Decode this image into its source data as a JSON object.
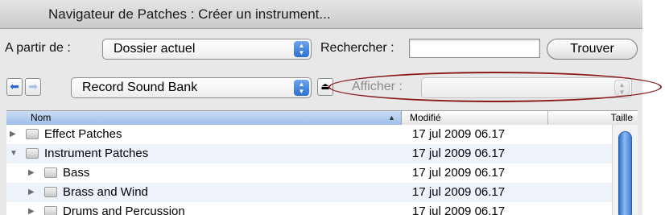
{
  "window": {
    "title": "Navigateur de Patches : Créer un instrument..."
  },
  "toolbar": {
    "from_label": "A partir de :",
    "from_value": "Dossier actuel",
    "search_label": "Rechercher :",
    "search_value": "",
    "find_button": "Trouver"
  },
  "nav": {
    "back_icon": "back-arrow-icon",
    "forward_icon": "forward-arrow-icon",
    "location_value": "Record Sound Bank",
    "show_label": "Afficher :",
    "show_value": ""
  },
  "columns": {
    "name": "Nom",
    "modified": "Modifié",
    "size": "Taille"
  },
  "rows": [
    {
      "name": "Effect Patches",
      "date": "17 jul 2009 06.17",
      "expanded": false,
      "level": 0
    },
    {
      "name": "Instrument Patches",
      "date": "17 jul 2009 06.17",
      "expanded": true,
      "level": 0
    },
    {
      "name": "Bass",
      "date": "17 jul 2009 06.17",
      "expanded": false,
      "level": 1
    },
    {
      "name": "Brass and Wind",
      "date": "17 jul 2009 06.17",
      "expanded": false,
      "level": 1
    },
    {
      "name": "Drums and Percussion",
      "date": "17 jul 2009 06.17",
      "expanded": false,
      "level": 1
    }
  ],
  "colors": {
    "annotation_oval": "#8a1a1a",
    "selection_blue": "#2e6fcf",
    "alt_row": "#eef3fb"
  }
}
